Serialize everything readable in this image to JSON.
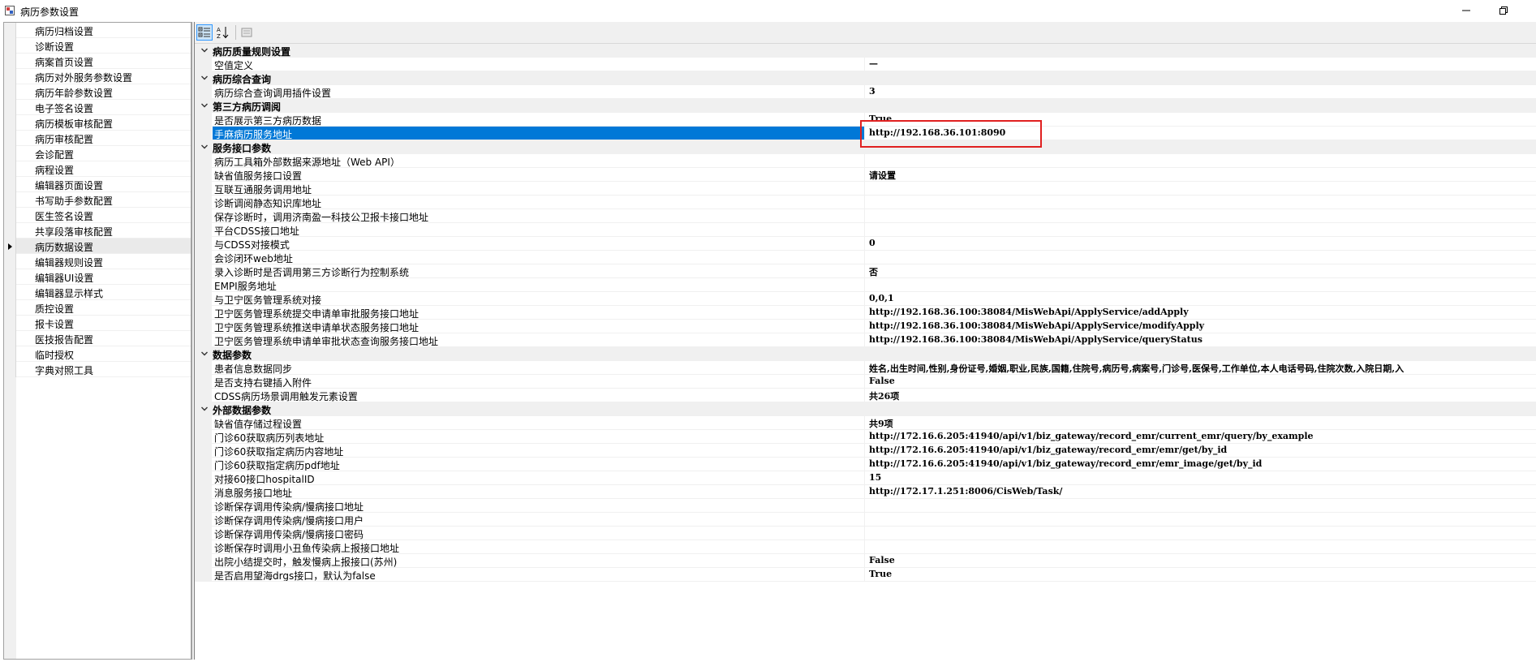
{
  "window": {
    "title": "病历参数设置"
  },
  "left_items": [
    "病历归档设置",
    "诊断设置",
    "病案首页设置",
    "病历对外服务参数设置",
    "病历年龄参数设置",
    "电子签名设置",
    "病历模板审核配置",
    "病历审核配置",
    "会诊配置",
    "病程设置",
    "编辑器页面设置",
    "书写助手参数配置",
    "医生签名设置",
    "共享段落审核配置",
    "病历数据设置",
    "编辑器规则设置",
    "编辑器UI设置",
    "编辑器显示样式",
    "质控设置",
    "报卡设置",
    "医技报告配置",
    "临时授权",
    "字典对照工具"
  ],
  "left_current_index": 14,
  "grid_rows": [
    {
      "type": "cat",
      "label": "病历质量规则设置"
    },
    {
      "type": "prop",
      "name": "空值定义",
      "value": "—"
    },
    {
      "type": "cat",
      "label": "病历综合查询"
    },
    {
      "type": "prop",
      "name": "病历综合查询调用插件设置",
      "value": "3"
    },
    {
      "type": "cat",
      "label": "第三方病历调阅"
    },
    {
      "type": "prop",
      "name": "是否展示第三方病历数据",
      "value": "True"
    },
    {
      "type": "prop",
      "name": "手麻病历服务地址",
      "value": "http://192.168.36.101:8090",
      "selected": true
    },
    {
      "type": "cat",
      "label": "服务接口参数"
    },
    {
      "type": "prop",
      "name": "病历工具箱外部数据来源地址（Web API）",
      "value": ""
    },
    {
      "type": "prop",
      "name": "缺省值服务接口设置",
      "value": "请设置"
    },
    {
      "type": "prop",
      "name": "互联互通服务调用地址",
      "value": ""
    },
    {
      "type": "prop",
      "name": "诊断调阅静态知识库地址",
      "value": ""
    },
    {
      "type": "prop",
      "name": "保存诊断时，调用济南盈一科技公卫报卡接口地址",
      "value": ""
    },
    {
      "type": "prop",
      "name": "平台CDSS接口地址",
      "value": ""
    },
    {
      "type": "prop",
      "name": "与CDSS对接模式",
      "value": "0"
    },
    {
      "type": "prop",
      "name": "会诊闭环web地址",
      "value": ""
    },
    {
      "type": "prop",
      "name": "录入诊断时是否调用第三方诊断行为控制系统",
      "value": "否"
    },
    {
      "type": "prop",
      "name": "EMPI服务地址",
      "value": ""
    },
    {
      "type": "prop",
      "name": "与卫宁医务管理系统对接",
      "value": "0,0,1"
    },
    {
      "type": "prop",
      "name": "卫宁医务管理系统提交申请单审批服务接口地址",
      "value": "http://192.168.36.100:38084/MisWebApi/ApplyService/addApply"
    },
    {
      "type": "prop",
      "name": "卫宁医务管理系统推送申请单状态服务接口地址",
      "value": "http://192.168.36.100:38084/MisWebApi/ApplyService/modifyApply"
    },
    {
      "type": "prop",
      "name": "卫宁医务管理系统申请单审批状态查询服务接口地址",
      "value": "http://192.168.36.100:38084/MisWebApi/ApplyService/queryStatus"
    },
    {
      "type": "cat",
      "label": "数据参数"
    },
    {
      "type": "prop",
      "name": "患者信息数据同步",
      "value": "姓名,出生时间,性别,身份证号,婚姻,职业,民族,国籍,住院号,病历号,病案号,门诊号,医保号,工作单位,本人电话号码,住院次数,入院日期,入"
    },
    {
      "type": "prop",
      "name": "是否支持右键插入附件",
      "value": "False"
    },
    {
      "type": "prop",
      "name": "CDSS病历场景调用触发元素设置",
      "value": "共26项"
    },
    {
      "type": "cat",
      "label": "外部数据参数"
    },
    {
      "type": "prop",
      "name": "缺省值存储过程设置",
      "value": "共9项"
    },
    {
      "type": "prop",
      "name": "门诊60获取病历列表地址",
      "value": "http://172.16.6.205:41940/api/v1/biz_gateway/record_emr/current_emr/query/by_example"
    },
    {
      "type": "prop",
      "name": "门诊60获取指定病历内容地址",
      "value": "http://172.16.6.205:41940/api/v1/biz_gateway/record_emr/emr/get/by_id"
    },
    {
      "type": "prop",
      "name": "门诊60获取指定病历pdf地址",
      "value": "http://172.16.6.205:41940/api/v1/biz_gateway/record_emr/emr_image/get/by_id"
    },
    {
      "type": "prop",
      "name": "对接60接口hospitalID",
      "value": "15"
    },
    {
      "type": "prop",
      "name": "消息服务接口地址",
      "value": "http://172.17.1.251:8006/CisWeb/Task/"
    },
    {
      "type": "prop",
      "name": "诊断保存调用传染病/慢病接口地址",
      "value": ""
    },
    {
      "type": "prop",
      "name": "诊断保存调用传染病/慢病接口用户",
      "value": ""
    },
    {
      "type": "prop",
      "name": "诊断保存调用传染病/慢病接口密码",
      "value": ""
    },
    {
      "type": "prop",
      "name": "诊断保存时调用小丑鱼传染病上报接口地址",
      "value": ""
    },
    {
      "type": "prop",
      "name": "出院小结提交时，触发慢病上报接口(苏州)",
      "value": "False"
    },
    {
      "type": "prop",
      "name": "是否启用望海drgs接口，默认为false",
      "value": "True"
    }
  ],
  "colors": {
    "selection": "#0078d7",
    "highlight_box": "#e02020",
    "category_bg": "#f0f0f0"
  },
  "icons": {
    "toolbar": [
      "categorized-icon",
      "alphabetical-sort-icon",
      "property-pages-icon"
    ],
    "window": [
      "minimize-icon",
      "restore-icon"
    ]
  }
}
